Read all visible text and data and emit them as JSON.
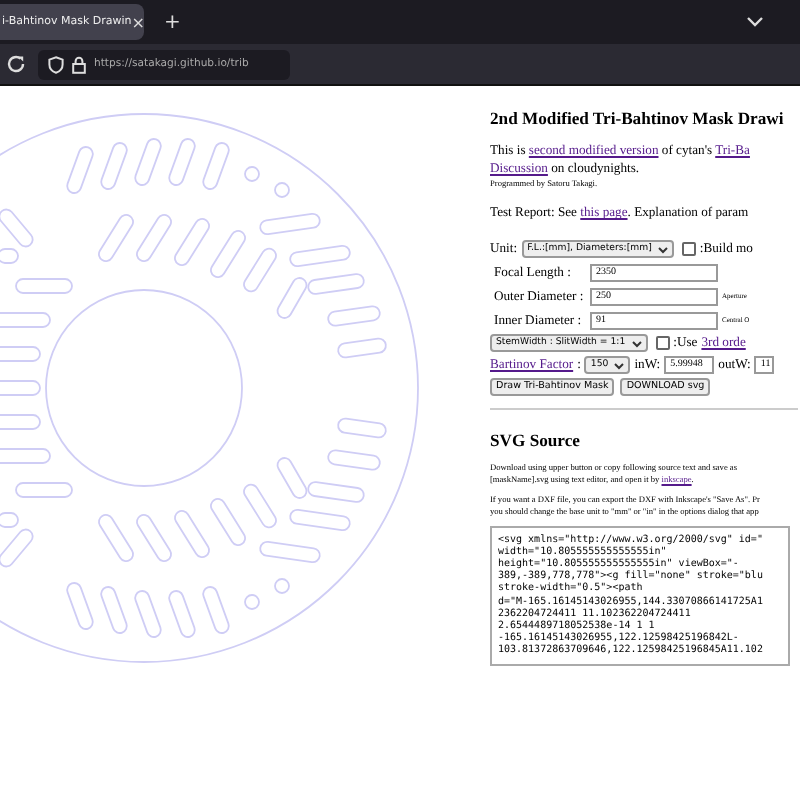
{
  "browser": {
    "tab": {
      "title": "i-Bahtinov Mask Drawin",
      "close": "×"
    },
    "new_tab": "+",
    "url": "https://satakagi.github.io/trib"
  },
  "page": {
    "title": "2nd Modified Tri-Bahtinov Mask Drawi",
    "intro": [
      {
        "text": "This is ",
        "link": false
      },
      {
        "text": "second modified version",
        "link": true
      },
      {
        "text": " of cytan's ",
        "link": false
      },
      {
        "text": "Tri-Ba",
        "link": true
      }
    ],
    "intro2": [
      {
        "text": "Discussion",
        "link": true
      },
      {
        "text": " on cloudynights.",
        "link": false
      }
    ],
    "credit": "Programmed by Satoru Takagi.",
    "report": [
      {
        "text": "Test Report: See ",
        "link": false
      },
      {
        "text": "this page",
        "link": true
      },
      {
        "text": ". Explanation of param",
        "link": false
      }
    ],
    "unit": {
      "label": "Unit:",
      "value": "F.L.:[mm], Diameters:[mm]",
      "check_label": ":Build mo",
      "checked": false
    },
    "fields": [
      {
        "label": "Focal Length :",
        "value": "2350"
      },
      {
        "label": "Outer Diameter :",
        "value": "250",
        "note": "Aperture"
      },
      {
        "label": "Inner Diameter :",
        "value": "91",
        "note": "Central O"
      }
    ],
    "ratio": {
      "value": "StemWidth : SlitWidth = 1:1",
      "check_label": ":Use",
      "checked": false,
      "link": "3rd orde"
    },
    "factor": {
      "link": "Bartinov Factor",
      "colon": ":",
      "value": "150",
      "inw_label": "inW:",
      "inw": "5.99948",
      "outw_label": "outW:",
      "outw": "11"
    },
    "buttons": [
      "Draw Tri-Bahtinov Mask",
      "DOWNLOAD svg"
    ],
    "svg_title": "SVG Source",
    "download_note": [
      {
        "text": "Download using upper button or copy following source text and save as",
        "link": false
      },
      {
        "text": "[maskName].svg using text editor, and open it by ",
        "link": false
      },
      {
        "text": "inkscape",
        "link": true
      },
      {
        "text": ".",
        "link": false
      }
    ],
    "dxf_lines": [
      "If you want a DXF file, you can export the DXF with Inkscape's \"Save As\". Pr",
      "you should change the base unit to \"mm\" or \"in\" in the options dialog that app"
    ],
    "source": "<svg xmlns=\"http://www.w3.org/2000/svg\" id=\"\nwidth=\"10.805555555555555in\"\nheight=\"10.805555555555555in\" viewBox=\"-\n389,-389,778,778\"><g fill=\"none\" stroke=\"blu\nstroke-width=\"0.5\"><path\nd=\"M-165.16145143026955,144.33070866141725A1\n2362204724411 11.102362204724411\n2.6544489718052538e-14 1 1\n-165.16145143026955,122.12598425196842L-\n103.81372863709646,122.12598425196845A11.102"
  }
}
